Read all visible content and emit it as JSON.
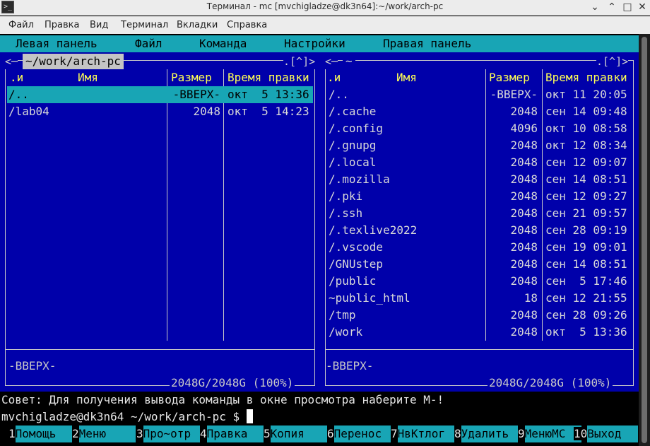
{
  "window": {
    "title": "Терминал - mc [mvchigladze@dk3n64]:~/work/arch-pc",
    "icon": "terminal-icon",
    "app_icon_glyph": ">_",
    "minimize_glyph": "⌄",
    "maximize_glyph": "⌃",
    "restore_glyph": "□",
    "close_glyph": "✕"
  },
  "menubar": [
    "Файл",
    "Правка",
    "Вид",
    "Терминал",
    "Вкладки",
    "Справка"
  ],
  "mc_menu": [
    "Левая панель",
    "Файл",
    "Команда",
    "Настройки",
    "Правая панель"
  ],
  "left_panel": {
    "path": " ~/work/arch-pc ",
    "corner_left": "<─",
    "corner_right": ".[^]>",
    "headers": {
      "name_prefix": ".и",
      "name": "Имя",
      "size": "Размер",
      "time": "Время правки"
    },
    "rows": [
      {
        "name": "/..",
        "size": "-ВВЕРХ-",
        "time": "окт  5 13:36",
        "selected": true
      },
      {
        "name": "/lab04",
        "size": "2048",
        "time": "окт  5 14:23",
        "selected": false
      }
    ],
    "mini_status": "-ВВЕРХ-",
    "usage": "2048G/2048G (100%)"
  },
  "right_panel": {
    "path": " ~ ",
    "corner_left": "<─",
    "corner_right": ".[^]>",
    "headers": {
      "name_prefix": ".и",
      "name": "Имя",
      "size": "Размер",
      "time": "Время правки"
    },
    "rows": [
      {
        "name": "/..",
        "size": "-ВВЕРХ-",
        "time": "окт 11 20:05"
      },
      {
        "name": "/.cache",
        "size": "2048",
        "time": "сен 14 09:48"
      },
      {
        "name": "/.config",
        "size": "4096",
        "time": "окт 10 08:58"
      },
      {
        "name": "/.gnupg",
        "size": "2048",
        "time": "окт 12 08:34"
      },
      {
        "name": "/.local",
        "size": "2048",
        "time": "сен 12 09:07"
      },
      {
        "name": "/.mozilla",
        "size": "2048",
        "time": "сен 14 08:51"
      },
      {
        "name": "/.pki",
        "size": "2048",
        "time": "сен 12 09:27"
      },
      {
        "name": "/.ssh",
        "size": "2048",
        "time": "сен 21 09:57"
      },
      {
        "name": "/.texlive2022",
        "size": "2048",
        "time": "сен 28 09:19"
      },
      {
        "name": "/.vscode",
        "size": "2048",
        "time": "сен 19 09:01"
      },
      {
        "name": "/GNUstep",
        "size": "2048",
        "time": "сен 14 08:51"
      },
      {
        "name": "/public",
        "size": "2048",
        "time": "сен  5 17:46"
      },
      {
        "name": "~public_html",
        "size": "18",
        "time": "сен 12 21:55"
      },
      {
        "name": "/tmp",
        "size": "2048",
        "time": "сен 28 09:26"
      },
      {
        "name": "/work",
        "size": "2048",
        "time": "окт  5 13:36"
      }
    ],
    "mini_status": "-ВВЕРХ-",
    "usage": "2048G/2048G (100%)"
  },
  "hint": "Совет: Для получения вывода команды в окне просмотра наберите M-!",
  "prompt": "mvchigladze@dk3n64 ~/work/arch-pc $ ",
  "fkeys": [
    {
      "num": "1",
      "label": "Помощь"
    },
    {
      "num": "2",
      "label": "Меню"
    },
    {
      "num": "3",
      "label": "Про~отр"
    },
    {
      "num": "4",
      "label": "Правка"
    },
    {
      "num": "5",
      "label": "Копия"
    },
    {
      "num": "6",
      "label": "Перенос"
    },
    {
      "num": "7",
      "label": "НвКтлог"
    },
    {
      "num": "8",
      "label": "Удалить"
    },
    {
      "num": "9",
      "label": "МенюMC"
    },
    {
      "num": "10",
      "label": "Выход"
    }
  ],
  "colors": {
    "panel_bg": "#0000aa",
    "accent_cyan": "#18a5b5",
    "header_yellow": "#ffff55"
  }
}
